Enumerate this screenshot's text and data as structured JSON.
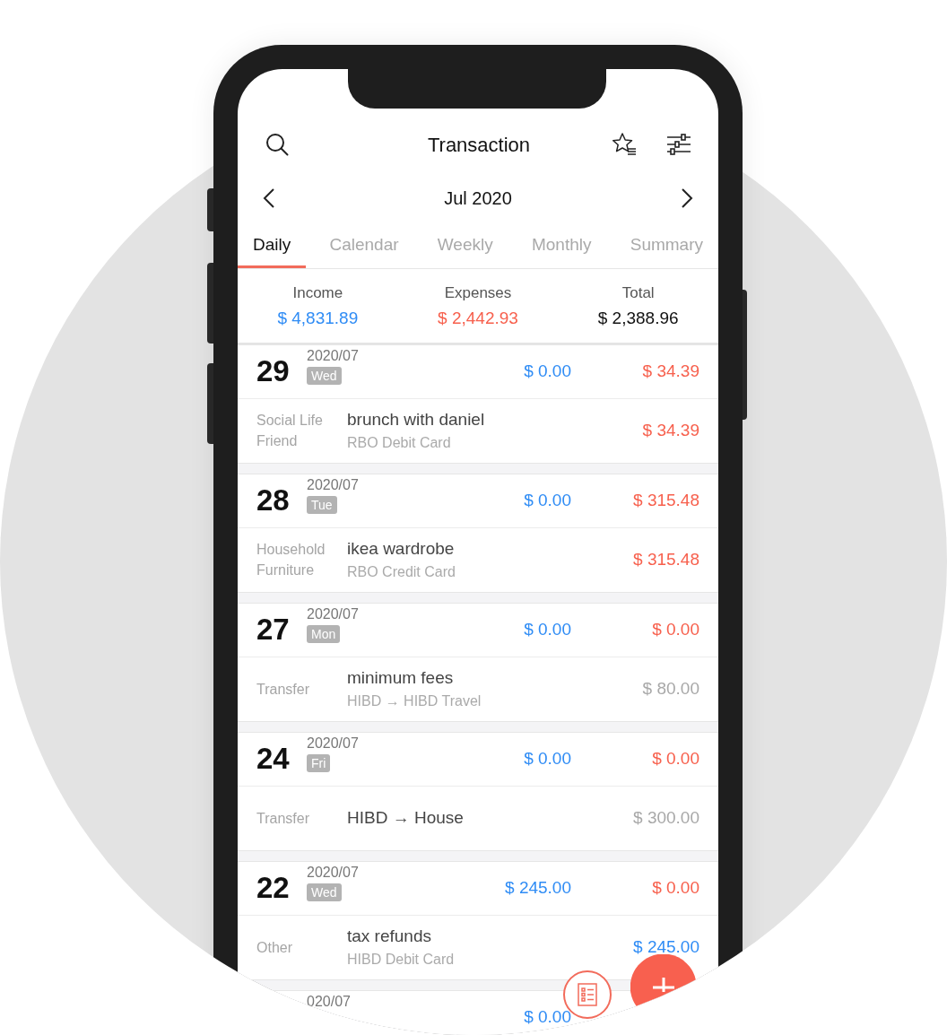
{
  "header": {
    "title": "Transaction"
  },
  "month": {
    "label": "Jul 2020"
  },
  "tabs": [
    {
      "label": "Daily",
      "selected": true
    },
    {
      "label": "Calendar",
      "selected": false
    },
    {
      "label": "Weekly",
      "selected": false
    },
    {
      "label": "Monthly",
      "selected": false
    },
    {
      "label": "Summary",
      "selected": false
    }
  ],
  "summary": [
    {
      "label": "Income",
      "value": "$ 4,831.89",
      "kind": "income"
    },
    {
      "label": "Expenses",
      "value": "$ 2,442.93",
      "kind": "expense"
    },
    {
      "label": "Total",
      "value": "$ 2,388.96",
      "kind": "total"
    }
  ],
  "days": [
    {
      "day": "29",
      "month": "2020/07",
      "weekday": "Wed",
      "income": "$ 0.00",
      "expense": "$ 34.39",
      "transactions": [
        {
          "category": "Social Life",
          "subcategory": "Friend",
          "note": "brunch with daniel",
          "account": "RBO Debit Card",
          "amount": "$ 34.39",
          "kind": "expense"
        }
      ]
    },
    {
      "day": "28",
      "month": "2020/07",
      "weekday": "Tue",
      "income": "$ 0.00",
      "expense": "$ 315.48",
      "transactions": [
        {
          "category": "Household",
          "subcategory": "Furniture",
          "note": "ikea wardrobe",
          "account": "RBO Credit Card",
          "amount": "$ 315.48",
          "kind": "expense"
        }
      ]
    },
    {
      "day": "27",
      "month": "2020/07",
      "weekday": "Mon",
      "income": "$ 0.00",
      "expense": "$ 0.00",
      "transactions": [
        {
          "category": "Transfer",
          "note": "minimum fees",
          "account": "HIBD → HIBD Travel",
          "amount": "$ 80.00",
          "kind": "transfer"
        }
      ]
    },
    {
      "day": "24",
      "month": "2020/07",
      "weekday": "Fri",
      "income": "$ 0.00",
      "expense": "$ 0.00",
      "transactions": [
        {
          "category": "Transfer",
          "note": "HIBD → House",
          "amount": "$ 300.00",
          "kind": "transfer"
        }
      ]
    },
    {
      "day": "22",
      "month": "2020/07",
      "weekday": "Wed",
      "income": "$ 245.00",
      "expense": "$ 0.00",
      "transactions": [
        {
          "category": "Other",
          "note": "tax refunds",
          "account": "HIBD Debit Card",
          "amount": "$ 245.00",
          "kind": "income"
        }
      ]
    },
    {
      "month": "020/07",
      "income": "$ 0.00"
    }
  ]
}
